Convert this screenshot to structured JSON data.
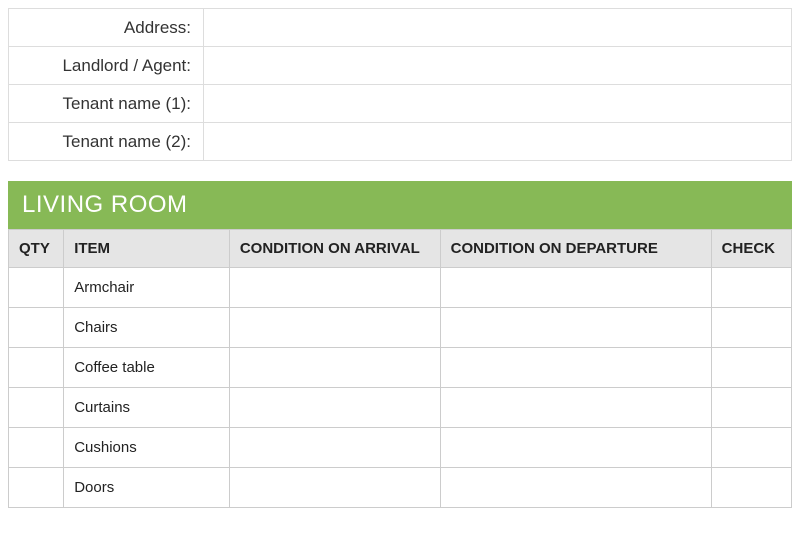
{
  "info_fields": {
    "address_label": "Address:",
    "address_value": "",
    "landlord_label": "Landlord / Agent:",
    "landlord_value": "",
    "tenant1_label": "Tenant name (1):",
    "tenant1_value": "",
    "tenant2_label": "Tenant name (2):",
    "tenant2_value": ""
  },
  "section": {
    "title": "LIVING ROOM"
  },
  "headers": {
    "qty": "QTY",
    "item": "ITEM",
    "arrival": "CONDITION ON ARRIVAL",
    "departure": "CONDITION ON DEPARTURE",
    "check": "CHECK"
  },
  "rows": [
    {
      "qty": "",
      "item": "Armchair",
      "arrival": "",
      "departure": "",
      "check": ""
    },
    {
      "qty": "",
      "item": "Chairs",
      "arrival": "",
      "departure": "",
      "check": ""
    },
    {
      "qty": "",
      "item": "Coffee table",
      "arrival": "",
      "departure": "",
      "check": ""
    },
    {
      "qty": "",
      "item": "Curtains",
      "arrival": "",
      "departure": "",
      "check": ""
    },
    {
      "qty": "",
      "item": "Cushions",
      "arrival": "",
      "departure": "",
      "check": ""
    },
    {
      "qty": "",
      "item": "Doors",
      "arrival": "",
      "departure": "",
      "check": ""
    }
  ]
}
